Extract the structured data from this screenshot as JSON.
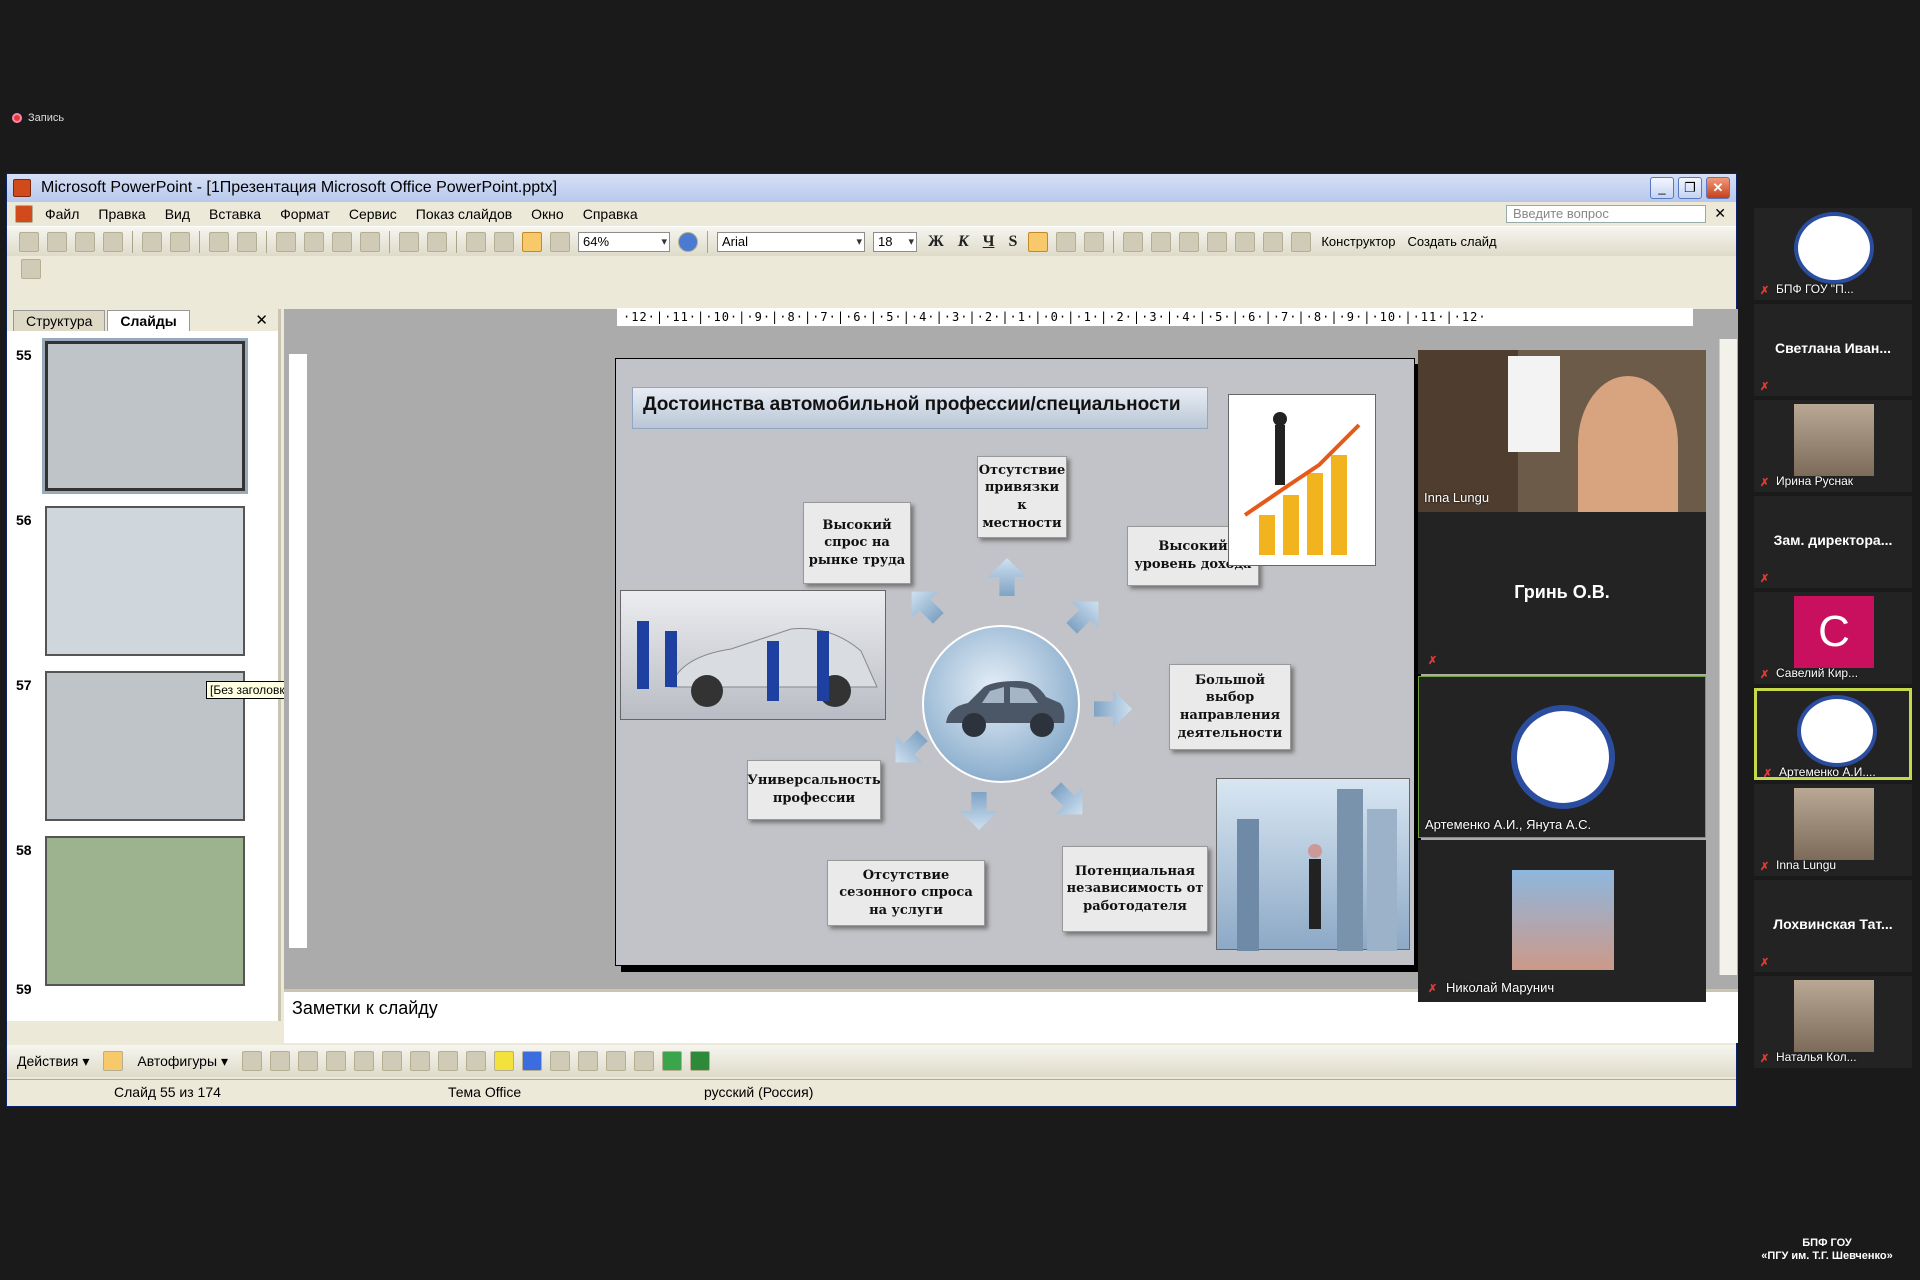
{
  "recording": {
    "label": "Запись"
  },
  "ppt": {
    "title": "Microsoft PowerPoint - [1Презентация Microsoft Office PowerPoint.pptx]",
    "menu": [
      "Файл",
      "Правка",
      "Вид",
      "Вставка",
      "Формат",
      "Сервис",
      "Показ слайдов",
      "Окно",
      "Справка"
    ],
    "ask_placeholder": "Введите вопрос",
    "zoom": "64%",
    "font": "Arial",
    "size": "18",
    "fmt": {
      "bold": "Ж",
      "italic": "К",
      "underline": "Ч",
      "shadow": "S"
    },
    "designer": "Конструктор",
    "new_slide": "Создать слайд",
    "tabs": [
      "Структура",
      "Слайды"
    ],
    "slide_numbers": [
      "55",
      "56",
      "57",
      "58",
      "59"
    ],
    "tooltip": "[Без заголовка]",
    "ruler": "·12·|·11·|·10·|·9·|·8·|·7·|·6·|·5·|·4·|·3·|·2·|·1·|·0·|·1·|·2·|·3·|·4·|·5·|·6·|·7·|·8·|·9·|·10·|·11·|·12·",
    "notes_placeholder": "Заметки к слайду",
    "draw": {
      "actions": "Действия",
      "autoshapes": "Автофигуры"
    },
    "status": {
      "slide": "Слайд 55 из 174",
      "theme": "Тема Office",
      "lang": "русский (Россия)"
    }
  },
  "slide": {
    "title": "Достоинства автомобильной профессии/специальности",
    "boxes": {
      "demand": "Высокий спрос на рынке труда",
      "location": "Отсутствие привязки к местности",
      "income": "Высокий уровень дохода",
      "choice": "Большой выбор направления деятельности",
      "independence": "Потенциальная независимость от работодателя",
      "season": "Отсутствие сезонного спроса на услуги",
      "universal": "Универсальность профессии"
    }
  },
  "panel": {
    "inna": "Inna Lungu",
    "grin": "Гринь О.В.",
    "artem": "Артеменко А.И., Янута А.С.",
    "nikolai": "Николай Марунич"
  },
  "gallery": [
    {
      "name": "БПФ ГОУ \"П...",
      "type": "logo-bpf"
    },
    {
      "name": "Светлана Иван...",
      "type": "text"
    },
    {
      "name": "Ирина Руснак",
      "type": "video"
    },
    {
      "name": "Зам. директора...",
      "type": "text"
    },
    {
      "name": "Савелий Кир...",
      "type": "avatar",
      "letter": "С"
    },
    {
      "name": "Артеменко А.И....",
      "type": "logo-ast",
      "active": true
    },
    {
      "name": "Inna Lungu",
      "type": "video"
    },
    {
      "name": "Лохвинская Тат...",
      "type": "text"
    },
    {
      "name": "Наталья Кол...",
      "type": "video"
    }
  ],
  "watermark": {
    "line1": "БПФ ГОУ",
    "line2": "«ПГУ им. Т.Г. Шевченко»"
  },
  "colors": {
    "avatar": "#c8105e",
    "active_border": "#c6d94a",
    "mic_muted": "#e53935"
  }
}
